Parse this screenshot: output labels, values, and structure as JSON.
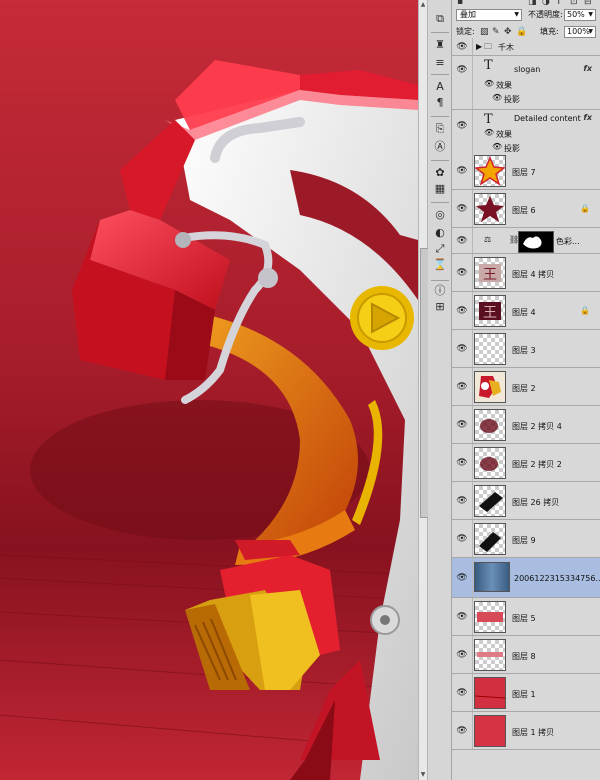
{
  "options": {
    "blend_mode": "叠加",
    "opacity_label": "不透明度:",
    "opacity_value": "50%",
    "lock_label": "锁定:",
    "fill_label": "填充:",
    "fill_value": "100%"
  },
  "layers": {
    "group": {
      "name": "千木"
    },
    "slogan": {
      "name": "slogan",
      "effects_label": "效果",
      "shadow_label": "投影"
    },
    "detailed": {
      "name": "Detailed content",
      "effects_label": "效果",
      "shadow_label": "投影"
    },
    "items": [
      {
        "name": "图层 7"
      },
      {
        "name": "图层 6"
      },
      {
        "name": "色彩..."
      },
      {
        "name": "图层 4 拷贝"
      },
      {
        "name": "图层 4"
      },
      {
        "name": "图层 3"
      },
      {
        "name": "图层 2"
      },
      {
        "name": "图层 2 拷贝 4"
      },
      {
        "name": "图层 2 拷贝 2"
      },
      {
        "name": "图层 26 拷贝"
      },
      {
        "name": "图层 9"
      },
      {
        "name": "2006122315334756..."
      },
      {
        "name": "图层 5"
      },
      {
        "name": "图层 8"
      },
      {
        "name": "图层 1"
      },
      {
        "name": "图层 1 拷贝"
      }
    ]
  },
  "colors": {
    "canvas_red": "#b0202d",
    "selection": "#a8bde0",
    "panel": "#d8d8d8"
  }
}
